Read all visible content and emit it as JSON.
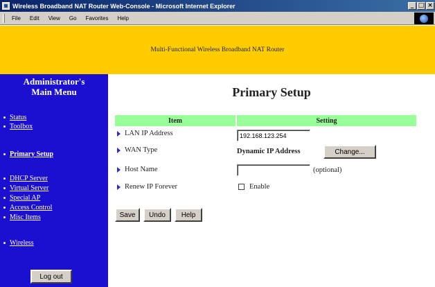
{
  "window": {
    "title": "Wireless Broadband NAT Router Web-Console - Microsoft Internet Explorer",
    "controls": [
      "_",
      "□",
      "×"
    ]
  },
  "menubar": {
    "items": [
      "File",
      "Edit",
      "View",
      "Go",
      "Favorites",
      "Help"
    ]
  },
  "banner": {
    "text": "Multi-Functional Wireless Broadband NAT Router"
  },
  "sidebar": {
    "title_line1": "Administrator's",
    "title_line2": "Main Menu",
    "items": [
      "Status",
      "Toolbox",
      "Primary Setup",
      "DHCP Server",
      "Virtual Server",
      "Special AP",
      "Access Control",
      "Misc Items",
      "Wireless"
    ],
    "active": "Primary Setup",
    "logout_label": "Log out"
  },
  "main": {
    "title": "Primary Setup",
    "header_item": "Item",
    "header_setting": "Setting",
    "rows": {
      "lan_ip": {
        "label": "LAN IP Address",
        "value": "192.168.123.254"
      },
      "wan_type": {
        "label": "WAN Type",
        "value": "Dynamic IP Address",
        "button": "Change..."
      },
      "host_name": {
        "label": "Host Name",
        "value": "",
        "note": "(optional)"
      },
      "renew_ip": {
        "label": "Renew IP Forever",
        "checkbox_label": "Enable",
        "checked": false
      }
    },
    "buttons": {
      "save": "Save",
      "undo": "Undo",
      "help": "Help"
    }
  },
  "colors": {
    "banner": "#ffcc00",
    "sidebar": "#1b0fd0",
    "table_header": "#99ff99",
    "titlebar": "#0a246a"
  }
}
